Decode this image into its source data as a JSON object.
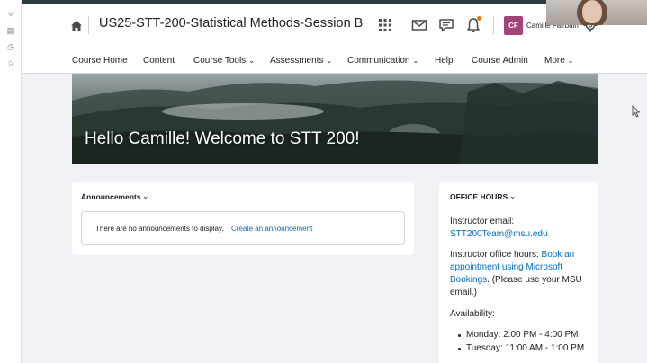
{
  "course": {
    "title": "US25-STT-200-Statistical Methods-Session B"
  },
  "user": {
    "initials": "CF",
    "name": "Camille Fairbairn"
  },
  "nav": {
    "items": [
      {
        "label": "Course Home",
        "has_menu": false
      },
      {
        "label": "Content",
        "has_menu": false
      },
      {
        "label": "Course Tools",
        "has_menu": true
      },
      {
        "label": "Assessments",
        "has_menu": true
      },
      {
        "label": "Communication",
        "has_menu": true
      },
      {
        "label": "Help",
        "has_menu": false
      },
      {
        "label": "Course Admin",
        "has_menu": false
      },
      {
        "label": "More",
        "has_menu": true
      }
    ]
  },
  "hero": {
    "welcome": "Hello Camille! Welcome to STT 200!"
  },
  "announcements": {
    "heading": "Announcements",
    "empty_text": "There are no announcements to display.",
    "create_link": "Create an announcement"
  },
  "office_hours": {
    "heading": "OFFICE HOURS",
    "email_label": "Instructor email:",
    "email": "STT200Team@msu.edu",
    "hours_label": "Instructor office hours:",
    "book_link": "Book an appointment using Microsoft Bookings",
    "hours_note": ". (Please use your MSU email.)",
    "availability_label": "Availability:",
    "availability": [
      "Monday: 2:00 PM - 4:00 PM",
      "Tuesday: 11:00 AM - 1:00 PM"
    ]
  },
  "icons": {
    "home": "home-icon",
    "apps": "app-grid-icon",
    "mail": "mail-icon",
    "chat": "chat-icon",
    "bell": "bell-icon",
    "gear": "gear-icon"
  },
  "colors": {
    "link": "#006fbf",
    "avatar": "#a34477",
    "notification": "#e87511"
  }
}
